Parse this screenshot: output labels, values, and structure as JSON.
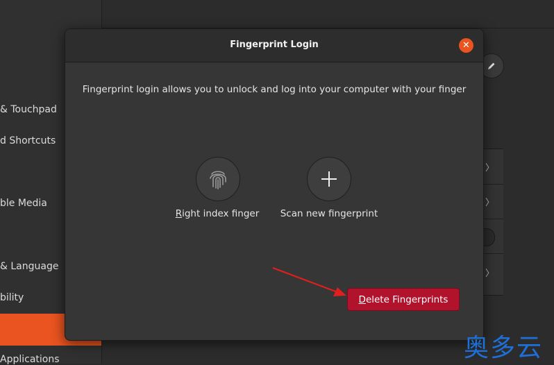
{
  "sidebar": {
    "items": [
      {
        "label": "& Touchpad"
      },
      {
        "label": "d Shortcuts"
      },
      {
        "label": "ble Media"
      },
      {
        "label": "& Language"
      },
      {
        "label": "bility"
      },
      {
        "label": "Applications"
      }
    ]
  },
  "dialog": {
    "title": "Fingerprint Login",
    "close_icon": "✕",
    "description": "Fingerprint login allows you to unlock and log into your computer with your finger",
    "fingers": [
      {
        "mnemonic": "R",
        "label_rest": "ight index finger",
        "icon": "fingerprint-icon"
      },
      {
        "label": "Scan new fingerprint",
        "icon": "plus-icon"
      }
    ],
    "delete_button": {
      "mnemonic": "D",
      "label_rest": "elete Fingerprints"
    }
  },
  "background": {
    "edit_icon": "pencil-icon",
    "chevron": "〉"
  },
  "watermark": "奥多云",
  "colors": {
    "accent": "#e95420",
    "destructive": "#b0132b",
    "annotation_arrow": "#e0201c",
    "watermark": "#1e6fd8"
  }
}
